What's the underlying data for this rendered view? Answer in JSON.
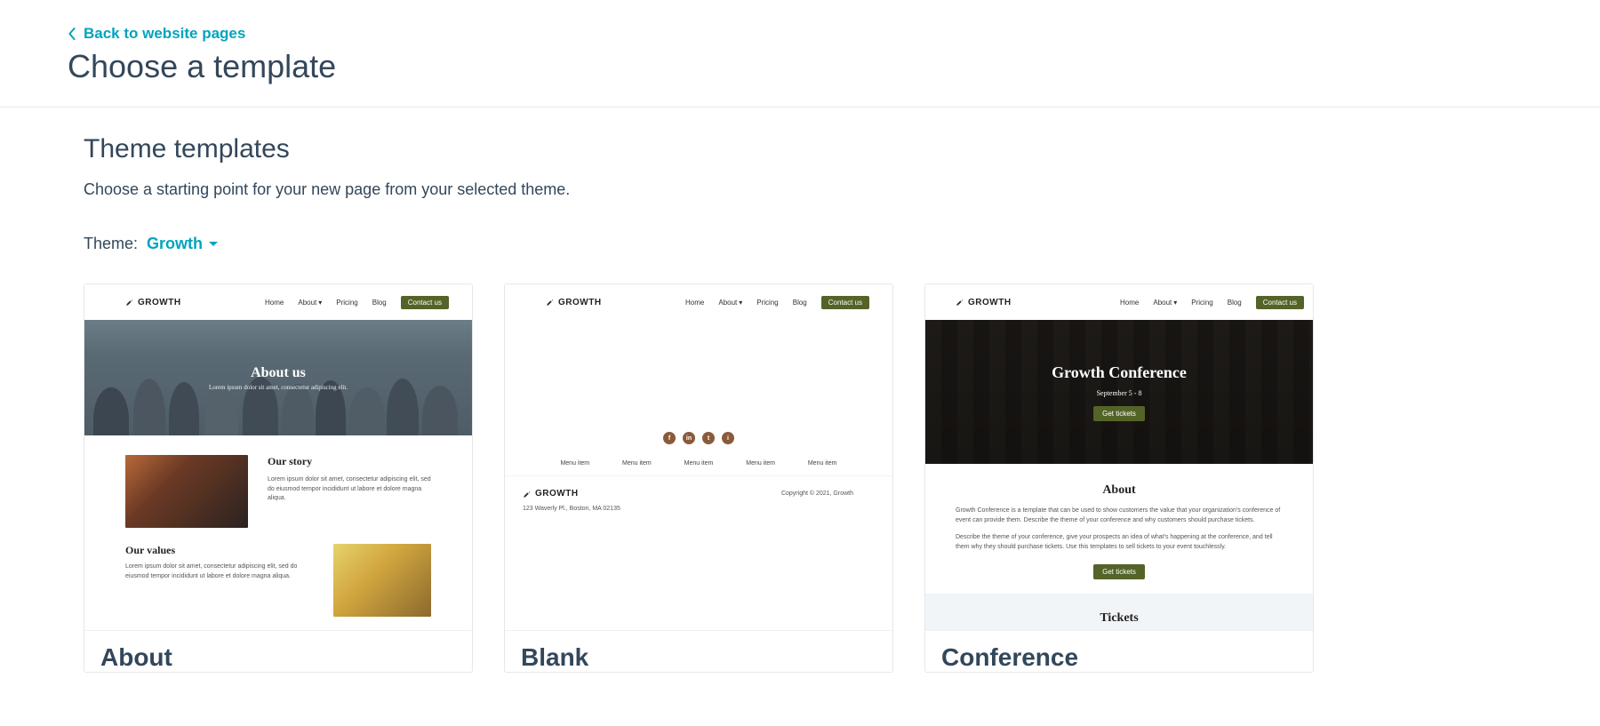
{
  "back_link": "Back to website pages",
  "page_title": "Choose a template",
  "section_title": "Theme templates",
  "section_sub": "Choose a starting point for your new page from your selected theme.",
  "theme_label": "Theme:",
  "theme_selected": "Growth",
  "mini_nav": {
    "brand": "GROWTH",
    "items": [
      "Home",
      "About",
      "Pricing",
      "Blog"
    ],
    "cta": "Contact us"
  },
  "cards": [
    {
      "title": "About",
      "hero_title": "About us",
      "hero_sub": "Lorem ipsum dolor sit amet, consectetur adipiscing elit.",
      "story_title": "Our story",
      "story_body": "Lorem ipsum dolor sit amet, consectetur adipiscing elit, sed do eiusmod tempor incididunt ut labore et dolore magna aliqua.",
      "values_title": "Our values",
      "values_body": "Lorem ipsum dolor sit amet, consectetur adipiscing elit, sed do eiusmod tempor incididunt ut labore et dolore magna aliqua."
    },
    {
      "title": "Blank",
      "menu_item": "Menu item",
      "copyright": "Copyright © 2021, Growth",
      "address": "123 Waverly Pl., Boston, MA 02135"
    },
    {
      "title": "Conference",
      "hero_title": "Growth Conference",
      "hero_dates": "September 5 - 8",
      "hero_cta": "Get tickets",
      "about_title": "About",
      "about_p1": "Growth Conference is a template that can be used to show customers the value that your organization's conference of event can provide them. Describe the theme of your conference and why customers should purchase tickets.",
      "about_p2": "Describe the theme of your conference, give your prospects an idea of what's happening at the conference, and tell them why they should purchase tickets. Use this templates to sell tickets to your event touchlessly.",
      "about_cta": "Get tickets",
      "tickets_title": "Tickets"
    }
  ]
}
